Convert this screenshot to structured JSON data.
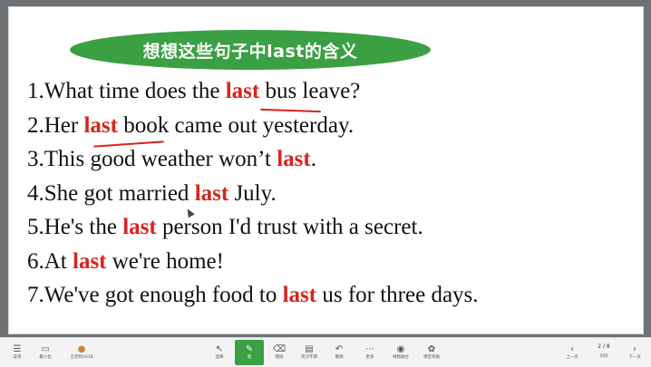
{
  "title": "想想这些句子中last的含义",
  "sentences": [
    {
      "before": "1.What time does the ",
      "keyword": "last",
      "after": " bus leave?"
    },
    {
      "before": "2.Her ",
      "keyword": "last",
      "after": " book came out yesterday."
    },
    {
      "before": "3.This good weather won’t ",
      "keyword": "last",
      "after": "."
    },
    {
      "before": "4.She got married ",
      "keyword": "last",
      "after": " July."
    },
    {
      "before": "5.He's the ",
      "keyword": "last",
      "after": " person I'd trust with a secret."
    },
    {
      "before": "6.At ",
      "keyword": "last",
      "after": " we're home!"
    },
    {
      "before": "7.We've got enough food to ",
      "keyword": "last",
      "after": " us for three days."
    }
  ],
  "toolbar": {
    "menu_label": "菜单",
    "board_label": "最小化",
    "user_label": "王老师2018",
    "select_label": "选择",
    "pen_label": "笔",
    "eraser_label": "擦除",
    "dictionary_label": "英汉字典",
    "undo_label": "撤销",
    "more_label": "更多",
    "camera_label": "视频展台",
    "gift_label": "课堂奖励",
    "prev_label": "上一页",
    "page_indicator": "2 / 8",
    "pages_label": "页码",
    "next_label": "下一页"
  },
  "colors": {
    "keyword": "#d9241c",
    "banner": "#3aa043",
    "active_tool": "#3aa043"
  }
}
